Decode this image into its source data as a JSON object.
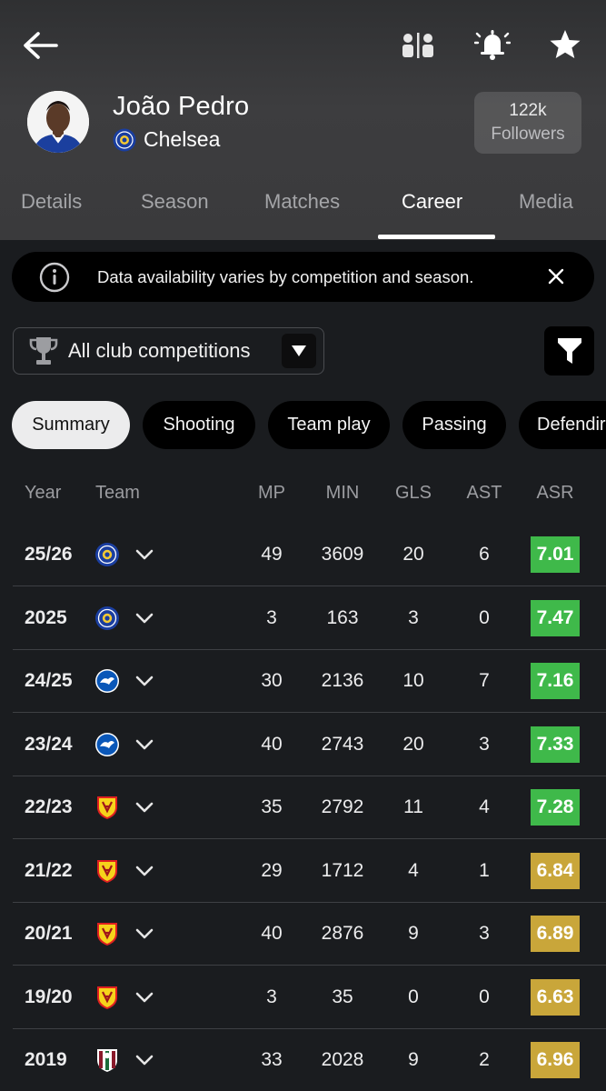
{
  "player": {
    "name": "João Pedro",
    "club": "Chelsea"
  },
  "followers": {
    "count": "122k",
    "label": "Followers"
  },
  "tabs": [
    "Details",
    "Season",
    "Matches",
    "Career",
    "Media"
  ],
  "active_tab": "Career",
  "banner": {
    "text": "Data availability varies by competition and season."
  },
  "competition_filter": {
    "selected": "All club competitions"
  },
  "chips": [
    "Summary",
    "Shooting",
    "Team play",
    "Passing",
    "Defendir"
  ],
  "active_chip": "Summary",
  "columns": [
    "Year",
    "Team",
    "MP",
    "MIN",
    "GLS",
    "AST",
    "ASR"
  ],
  "colors": {
    "rating_high": "#3fb94a",
    "rating_mid": "#c9a63a"
  },
  "rows": [
    {
      "year": "25/26",
      "team": "chelsea",
      "mp": "49",
      "min": "3609",
      "gls": "20",
      "ast": "6",
      "asr": "7.01",
      "tier": "high"
    },
    {
      "year": "2025",
      "team": "chelsea",
      "mp": "3",
      "min": "163",
      "gls": "3",
      "ast": "0",
      "asr": "7.47",
      "tier": "high"
    },
    {
      "year": "24/25",
      "team": "brighton",
      "mp": "30",
      "min": "2136",
      "gls": "10",
      "ast": "7",
      "asr": "7.16",
      "tier": "high"
    },
    {
      "year": "23/24",
      "team": "brighton",
      "mp": "40",
      "min": "2743",
      "gls": "20",
      "ast": "3",
      "asr": "7.33",
      "tier": "high"
    },
    {
      "year": "22/23",
      "team": "watford",
      "mp": "35",
      "min": "2792",
      "gls": "11",
      "ast": "4",
      "asr": "7.28",
      "tier": "high"
    },
    {
      "year": "21/22",
      "team": "watford",
      "mp": "29",
      "min": "1712",
      "gls": "4",
      "ast": "1",
      "asr": "6.84",
      "tier": "mid"
    },
    {
      "year": "20/21",
      "team": "watford",
      "mp": "40",
      "min": "2876",
      "gls": "9",
      "ast": "3",
      "asr": "6.89",
      "tier": "mid"
    },
    {
      "year": "19/20",
      "team": "watford",
      "mp": "3",
      "min": "35",
      "gls": "0",
      "ast": "0",
      "asr": "6.63",
      "tier": "mid"
    },
    {
      "year": "2019",
      "team": "fluminense",
      "mp": "33",
      "min": "2028",
      "gls": "9",
      "ast": "2",
      "asr": "6.96",
      "tier": "mid"
    }
  ]
}
